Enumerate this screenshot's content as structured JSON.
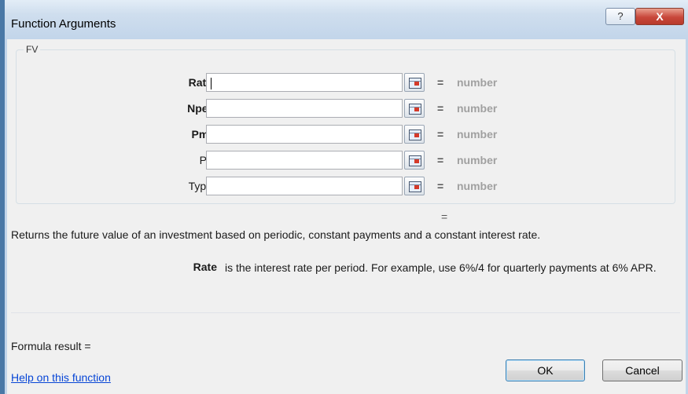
{
  "window": {
    "title": "Function Arguments",
    "help_glyph": "?",
    "close_glyph": "X"
  },
  "function": {
    "name": "FV",
    "arguments": [
      {
        "label": "Rate",
        "required": true,
        "value": "",
        "result": "number"
      },
      {
        "label": "Nper",
        "required": true,
        "value": "",
        "result": "number"
      },
      {
        "label": "Pmt",
        "required": true,
        "value": "",
        "result": "number"
      },
      {
        "label": "Pv",
        "required": false,
        "value": "",
        "result": "number"
      },
      {
        "label": "Type",
        "required": false,
        "value": "",
        "result": "number"
      }
    ],
    "equals": "=",
    "description": "Returns the future value of an investment based on periodic, constant payments and a constant interest rate.",
    "current_arg_name": "Rate",
    "current_arg_help": "is the interest rate per period. For example, use 6%/4 for quarterly payments at 6% APR."
  },
  "footer": {
    "formula_result_label": "Formula result =",
    "help_link": "Help on this function",
    "ok_label": "OK",
    "cancel_label": "Cancel"
  },
  "icons": {
    "ref_button": "collapse-dialog-icon",
    "help": "help-icon",
    "close": "close-icon"
  }
}
